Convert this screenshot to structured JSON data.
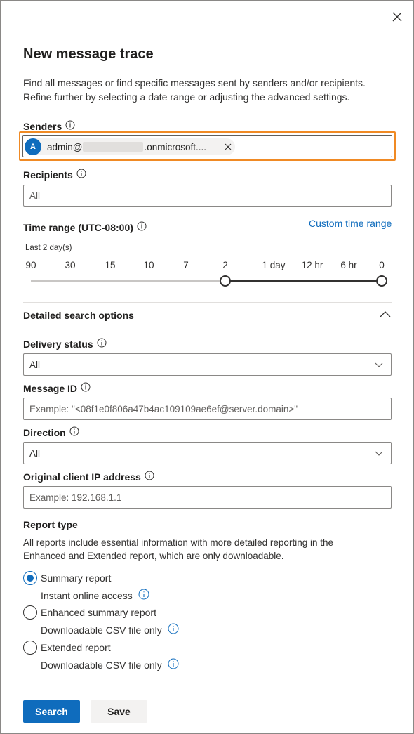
{
  "panel": {
    "title": "New message trace",
    "description": "Find all messages or find specific messages sent by senders and/or recipients. Refine further by selecting a date range or adjusting the advanced settings."
  },
  "senders": {
    "label": "Senders",
    "chip_initial": "A",
    "chip_prefix": "admin@",
    "chip_suffix": ".onmicrosoft....",
    "chip_remove": "×"
  },
  "recipients": {
    "label": "Recipients",
    "placeholder": "All"
  },
  "time_range": {
    "label": "Time range (UTC-08:00)",
    "custom_link": "Custom time range",
    "selected_label": "Last 2 day(s)",
    "ticks": [
      "90",
      "30",
      "15",
      "10",
      "7",
      "2",
      "1 day",
      "12 hr",
      "6 hr",
      "0"
    ],
    "selected_from_index": 5,
    "selected_to_index": 9
  },
  "detailed": {
    "label": "Detailed search options"
  },
  "delivery_status": {
    "label": "Delivery status",
    "value": "All"
  },
  "message_id": {
    "label": "Message ID",
    "placeholder": "Example: \"<08f1e0f806a47b4ac109109ae6ef@server.domain>\""
  },
  "direction": {
    "label": "Direction",
    "value": "All"
  },
  "client_ip": {
    "label": "Original client IP address",
    "placeholder": "Example: 192.168.1.1"
  },
  "report_type": {
    "label": "Report type",
    "description": "All reports include essential information with more detailed reporting in the Enhanced and Extended report, which are only downloadable.",
    "options": [
      {
        "label": "Summary report",
        "sub": "Instant online access",
        "checked": true
      },
      {
        "label": "Enhanced summary report",
        "sub": "Downloadable CSV file only",
        "checked": false
      },
      {
        "label": "Extended report",
        "sub": "Downloadable CSV file only",
        "checked": false
      }
    ]
  },
  "actions": {
    "search": "Search",
    "save": "Save"
  },
  "colors": {
    "accent": "#0f6cbd",
    "highlight": "#f08a24"
  }
}
